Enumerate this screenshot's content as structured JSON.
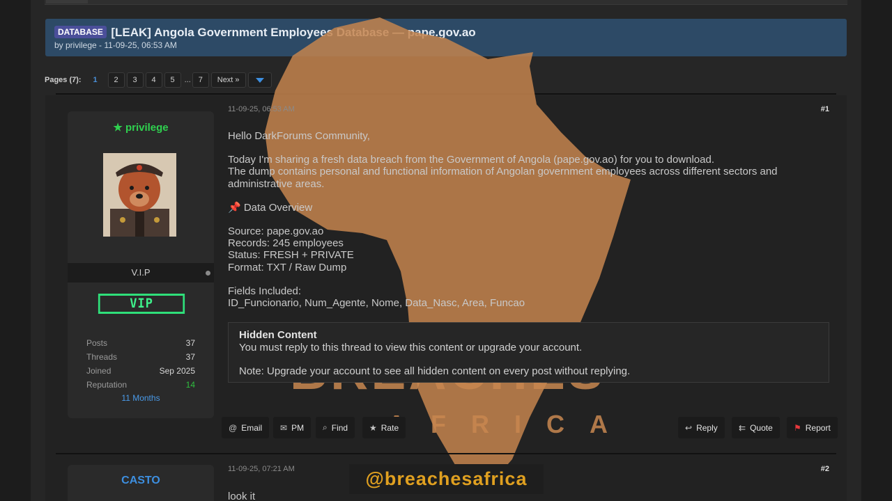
{
  "thread": {
    "prefix": "DATABASE",
    "title": "[LEAK] Angola Government Employees Database — pape.gov.ao",
    "meta": "by privilege - 11-09-25, 06:53 AM"
  },
  "pagination": {
    "label": "Pages (7):",
    "current": "1",
    "pages": [
      "2",
      "3",
      "4",
      "5"
    ],
    "ellipsis": "...",
    "last": "7",
    "next": "Next »"
  },
  "post1": {
    "author": "privilege",
    "author_color": "#2fd14f",
    "usergroup": "V.I.P",
    "badge": "VIP",
    "stats": [
      {
        "k": "Posts",
        "v": "37"
      },
      {
        "k": "Threads",
        "v": "37"
      },
      {
        "k": "Joined",
        "v": "Sep 2025"
      },
      {
        "k": "Reputation",
        "v": "14"
      }
    ],
    "reputation_color": "#2fbf3f",
    "months": "11 Months",
    "date": "11-09-25, 06:53 AM",
    "number": "#1",
    "lines": {
      "greeting": "Hello DarkForums Community,",
      "intro1": "Today I'm sharing a fresh data breach from the Government of Angola (pape.gov.ao) for you to download.",
      "intro2": "The dump contains personal and functional information of Angolan government employees across different sectors and administrative areas.",
      "overview": "📌 Data Overview",
      "source": "Source: pape.gov.ao",
      "records": "Records: 245 employees",
      "status": "Status: FRESH + PRIVATE",
      "format": "Format: TXT / Raw Dump",
      "fields_label": "Fields Included:",
      "fields": "ID_Funcionario, Num_Agente, Nome, Data_Nasc, Area, Funcao"
    },
    "hidden": {
      "title": "Hidden Content",
      "line1": "You must reply to this thread to view this content or upgrade your account.",
      "line2": "Note: Upgrade your account to see all hidden content on every post without replying."
    },
    "buttons": {
      "email": "Email",
      "pm": "PM",
      "find": "Find",
      "rate": "Rate",
      "reply": "Reply",
      "quote": "Quote",
      "report": "Report"
    }
  },
  "post2": {
    "author": "CASTO",
    "date": "11-09-25, 07:21 AM",
    "number": "#2",
    "body": "look it"
  },
  "watermark": {
    "title": "BREACHES",
    "subtitle": "AFRICA",
    "handle": "@breachesafrica"
  }
}
